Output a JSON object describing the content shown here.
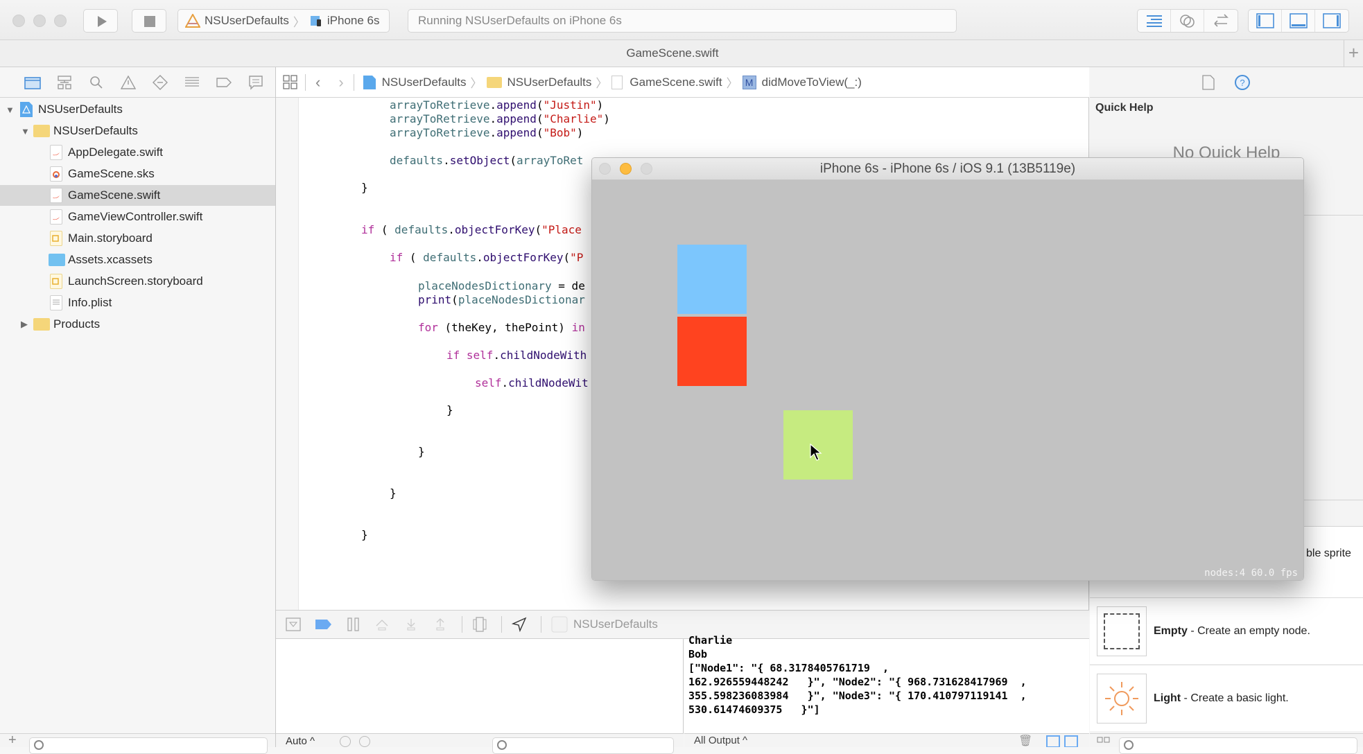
{
  "toolbar": {
    "scheme_project": "NSUserDefaults",
    "scheme_device": "iPhone 6s",
    "status": "Running NSUserDefaults on iPhone 6s"
  },
  "tab": {
    "title": "GameScene.swift"
  },
  "navigator": {
    "items": [
      {
        "label": "NSUserDefaults",
        "kind": "project",
        "expanded": true
      },
      {
        "label": "NSUserDefaults",
        "kind": "folder",
        "expanded": true
      },
      {
        "label": "AppDelegate.swift",
        "kind": "swift"
      },
      {
        "label": "GameScene.sks",
        "kind": "sks"
      },
      {
        "label": "GameScene.swift",
        "kind": "swift",
        "selected": true
      },
      {
        "label": "GameViewController.swift",
        "kind": "swift"
      },
      {
        "label": "Main.storyboard",
        "kind": "storyboard"
      },
      {
        "label": "Assets.xcassets",
        "kind": "assets"
      },
      {
        "label": "LaunchScreen.storyboard",
        "kind": "storyboard"
      },
      {
        "label": "Info.plist",
        "kind": "plist"
      },
      {
        "label": "Products",
        "kind": "folder",
        "expanded": false
      }
    ]
  },
  "jumpbar": {
    "crumbs": [
      "NSUserDefaults",
      "NSUserDefaults",
      "GameScene.swift",
      "didMoveToView(_:)"
    ]
  },
  "code": {
    "l1": {
      "obj": "arrayToRetrieve",
      "fn": "append",
      "arg": "\"Justin\""
    },
    "l2": {
      "obj": "arrayToRetrieve",
      "fn": "append",
      "arg": "\"Charlie\""
    },
    "l3": {
      "obj": "arrayToRetrieve",
      "fn": "append",
      "arg": "\"Bob\""
    },
    "l4": {
      "obj": "defaults",
      "fn": "setObject",
      "arg": "arrayToRet"
    },
    "l5": "}",
    "l6": {
      "kw": "if",
      "obj": "defaults",
      "fn": "objectForKey",
      "arg": "\"Place"
    },
    "l7": {
      "kw": "if",
      "obj": "defaults",
      "fn": "objectForKey",
      "arg": "\"P"
    },
    "l8": {
      "lhs": "placeNodesDictionary",
      "rest": " = de"
    },
    "l9": {
      "fn": "print",
      "arg": "placeNodesDictionar"
    },
    "l10": {
      "kw": "for",
      "rest": " (theKey, thePoint) ",
      "kw2": "in"
    },
    "l11": {
      "kw": "if",
      "self": "self",
      "fn": "childNodeWith"
    },
    "l12": {
      "self": "self",
      "fn": "childNodeWit"
    },
    "l13": "}",
    "l14": "}",
    "l15": "}",
    "l16": "}"
  },
  "debugbar": {
    "target": "NSUserDefaults"
  },
  "console": {
    "partial": "Charlie",
    "lines": [
      "Bob",
      "[\"Node1\": \"{ 68.3178405761719  ,",
      "162.926559448242   }\", \"Node2\": \"{ 968.731628417969  ,",
      "355.598236083984   }\", \"Node3\": \"{ 170.410797119141  ,",
      "530.61474609375   }\"]"
    ],
    "filter_label": "All Output ^"
  },
  "variables": {
    "scope_label": "Auto ^"
  },
  "inspector": {
    "quick_help_title": "Quick Help",
    "no_quick_help": "No Quick Help",
    "partial_item": "ble sprite",
    "library": [
      {
        "name": "Empty",
        "desc": " - Create an empty node."
      },
      {
        "name": "Light",
        "desc": " - Create a basic light."
      }
    ]
  },
  "simulator": {
    "title": "iPhone 6s - iPhone 6s / iOS 9.1 (13B5119e)",
    "stats": "nodes:4  60.0 fps",
    "sprites": [
      {
        "name": "blue",
        "color": "#7cc6fd"
      },
      {
        "name": "red",
        "color": "#ff431f"
      },
      {
        "name": "green",
        "color": "#c6eb80"
      }
    ]
  }
}
